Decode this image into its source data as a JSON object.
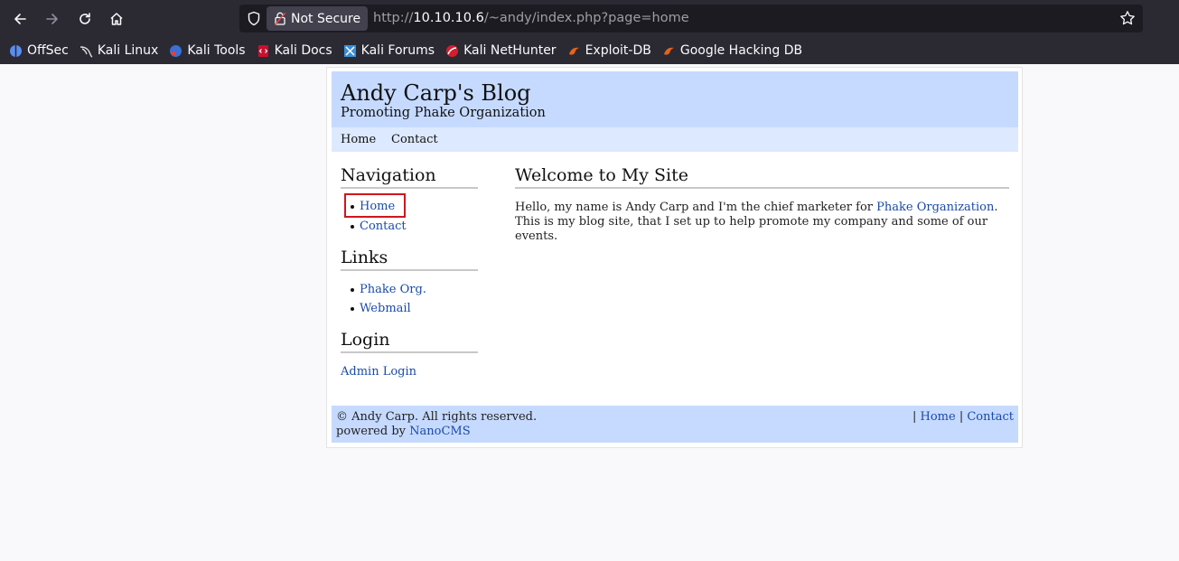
{
  "browser": {
    "security_label": "Not Secure",
    "url_prefix": "http://",
    "url_host": "10.10.10.6",
    "url_path": "/~andy/index.php?page=home",
    "bookmarks": [
      {
        "label": "OffSec",
        "icon": "offsec-icon",
        "color": "#5b8def"
      },
      {
        "label": "Kali Linux",
        "icon": "kali-dragon-icon",
        "color": "#e0e0e0"
      },
      {
        "label": "Kali Tools",
        "icon": "kali-tools-icon",
        "color": "#3b6fd6"
      },
      {
        "label": "Kali Docs",
        "icon": "kali-docs-icon",
        "color": "#c8102e"
      },
      {
        "label": "Kali Forums",
        "icon": "kali-forums-icon",
        "color": "#3a8fd6"
      },
      {
        "label": "Kali NetHunter",
        "icon": "nethunter-icon",
        "color": "#d21f2f"
      },
      {
        "label": "Exploit-DB",
        "icon": "exploitdb-icon",
        "color": "#e8621a"
      },
      {
        "label": "Google Hacking DB",
        "icon": "ghdb-icon",
        "color": "#e8621a"
      }
    ]
  },
  "site": {
    "title": "Andy Carp's Blog",
    "subtitle": "Promoting Phake Organization",
    "menu": [
      "Home",
      "Contact"
    ],
    "sidebar": {
      "navigation_heading": "Navigation",
      "navigation_items": [
        "Home",
        "Contact"
      ],
      "links_heading": "Links",
      "links_items": [
        "Phake Org.",
        "Webmail"
      ],
      "login_heading": "Login",
      "login_link": "Admin Login"
    },
    "main": {
      "heading": "Welcome to My Site",
      "text_before": "Hello, my name is Andy Carp and I'm the chief marketer for ",
      "text_link": "Phake Organization",
      "text_after": ". This is my blog site, that I set up to help promote my company and some of our events."
    },
    "footer": {
      "copyright": "© Andy Carp. All rights reserved.",
      "powered_prefix": "powered by ",
      "powered_link": "NanoCMS",
      "sep": "|",
      "links": [
        "Home",
        "Contact"
      ]
    }
  }
}
